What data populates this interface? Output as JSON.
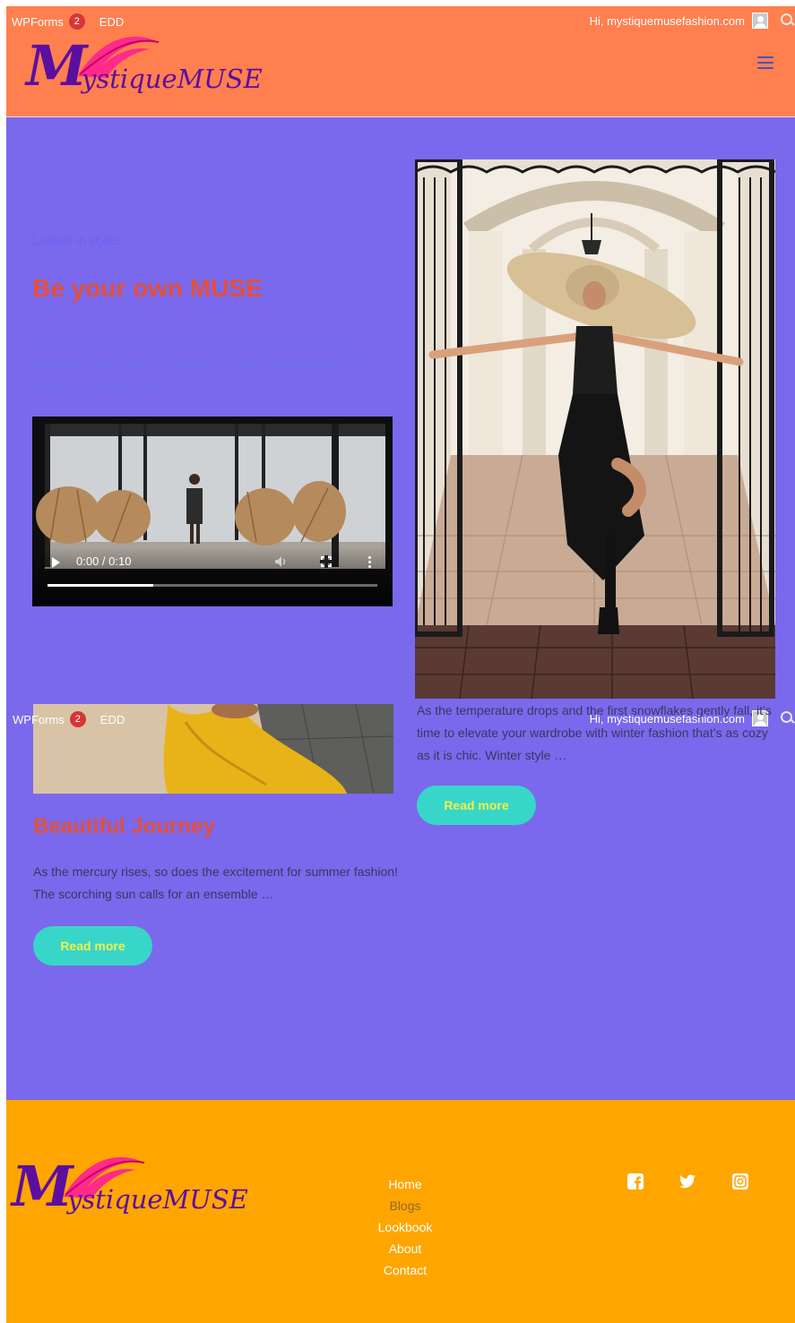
{
  "admin_bar": {
    "wpforms_label": "WPForms",
    "wpforms_count": "2",
    "edd_label": "EDD",
    "greeting": "Hi, mystiquemusefashion.com"
  },
  "header": {
    "logo_text": "ystiqueMUSE",
    "logo_letter": "M"
  },
  "hero": {
    "kicker": "Lastest in styles",
    "title": "Be your own MUSE",
    "quote": "“Elevate your style, set the trends, and be your own muse – because in the world of fashion, you’re the masterpiece that defines the latest style.”"
  },
  "video": {
    "time": "0:00 / 0:10",
    "progress": 0.32
  },
  "posts": [
    {
      "title": "Beautiful Journey",
      "excerpt": "As the mercury rises, so does the excitement for summer fashion! The scorching sun calls for an ensemble …",
      "button": "Read more"
    },
    {
      "excerpt": "As the temperature drops and the first snowflakes gently fall, it’s time to elevate your wardrobe with winter fashion that’s as cozy as it is chic. Winter style …",
      "button": "Read more"
    }
  ],
  "footer": {
    "logo_text": "ystiqueMUSE",
    "logo_letter": "M",
    "nav": [
      "Home",
      "Blogs",
      "Lookbook",
      "About",
      "Contact"
    ],
    "social": [
      "facebook-icon",
      "twitter-icon",
      "instagram-icon"
    ]
  },
  "colors": {
    "header_bg": "#ff7f4f",
    "main_bg": "#7a69ec",
    "footer_bg": "#ffa500",
    "accent_red": "#e2503c",
    "button_bg": "#38d6c8",
    "button_text": "#f0f04a"
  }
}
